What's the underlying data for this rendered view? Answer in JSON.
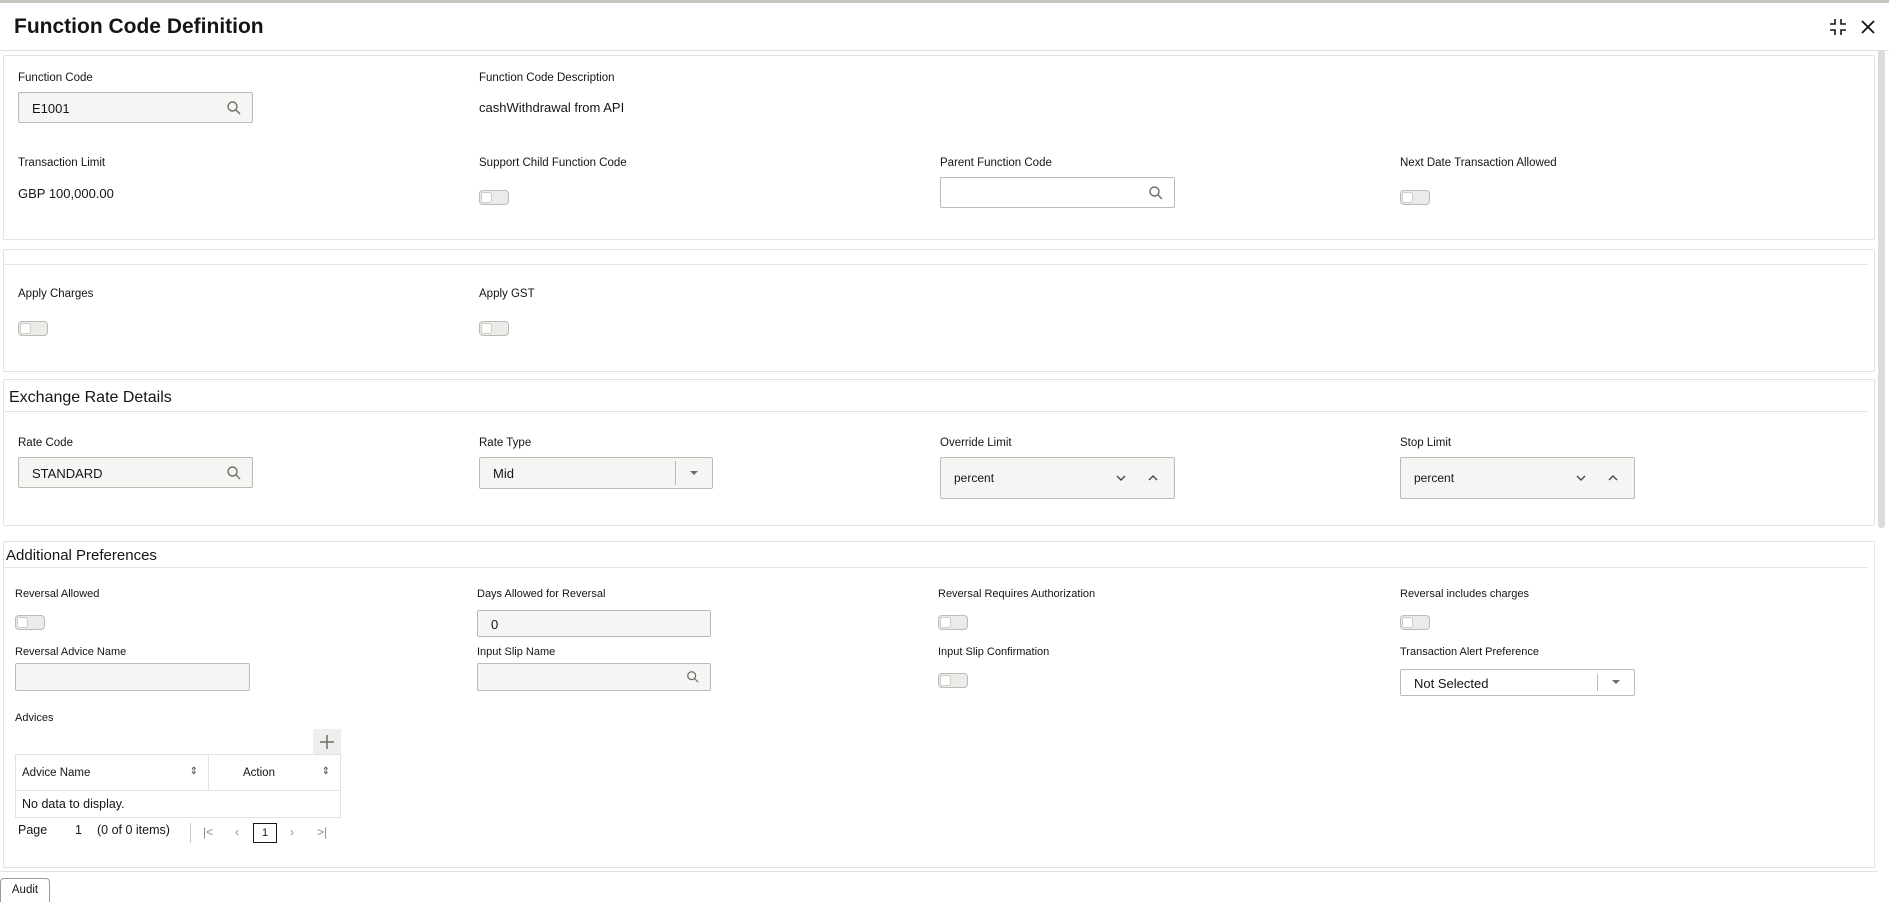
{
  "header": {
    "title": "Function Code Definition"
  },
  "main": {
    "function_code": {
      "label": "Function Code",
      "value": "E1001"
    },
    "function_code_description": {
      "label": "Function Code Description",
      "value": "cashWithdrawal from API"
    },
    "transaction_limit": {
      "label": "Transaction Limit",
      "value": "GBP 100,000.00"
    },
    "support_child": {
      "label": "Support Child Function Code"
    },
    "parent_function_code": {
      "label": "Parent Function Code",
      "value": ""
    },
    "next_date_txn": {
      "label": "Next Date Transaction Allowed"
    }
  },
  "charges": {
    "apply_charges": {
      "label": "Apply Charges"
    },
    "apply_gst": {
      "label": "Apply GST"
    }
  },
  "exchange": {
    "title": "Exchange Rate Details",
    "rate_code": {
      "label": "Rate Code",
      "value": "STANDARD"
    },
    "rate_type": {
      "label": "Rate Type",
      "value": "Mid"
    },
    "override_limit": {
      "label": "Override Limit",
      "value": "percent"
    },
    "stop_limit": {
      "label": "Stop Limit",
      "value": "percent"
    }
  },
  "prefs": {
    "title": "Additional Preferences",
    "reversal_allowed": {
      "label": "Reversal Allowed"
    },
    "days_allowed": {
      "label": "Days Allowed for Reversal",
      "value": "0"
    },
    "reversal_auth": {
      "label": "Reversal Requires Authorization"
    },
    "reversal_charges": {
      "label": "Reversal includes charges"
    },
    "reversal_advice": {
      "label": "Reversal Advice Name",
      "value": ""
    },
    "input_slip": {
      "label": "Input Slip Name",
      "value": ""
    },
    "input_slip_conf": {
      "label": "Input Slip Confirmation"
    },
    "alert_pref": {
      "label": "Transaction Alert Preference",
      "value": "Not Selected"
    }
  },
  "advices": {
    "title": "Advices",
    "columns": [
      "Advice Name",
      "Action"
    ],
    "empty_text": "No data to display.",
    "pager": {
      "page_label": "Page",
      "page_value": "1",
      "items_text": "(0 of 0 items)",
      "current_page": "1"
    }
  },
  "footer": {
    "audit_label": "Audit"
  }
}
